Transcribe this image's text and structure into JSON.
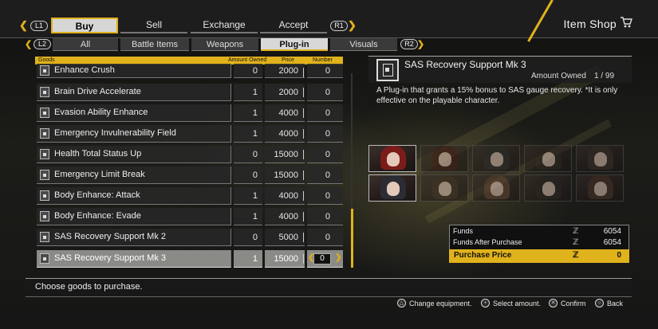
{
  "header": {
    "left_shoulder": "L1",
    "right_shoulder": "R1",
    "tabs": [
      {
        "label": "Buy",
        "active": true
      },
      {
        "label": "Sell",
        "active": false
      },
      {
        "label": "Exchange",
        "active": false
      },
      {
        "label": "Accept",
        "active": false
      }
    ],
    "title": "Item Shop"
  },
  "subtabs": {
    "left_shoulder": "L2",
    "right_shoulder": "R2",
    "items": [
      {
        "label": "All",
        "active": false
      },
      {
        "label": "Battle Items",
        "active": false
      },
      {
        "label": "Weapons",
        "active": false
      },
      {
        "label": "Plug-in",
        "active": true
      },
      {
        "label": "Visuals",
        "active": false
      }
    ]
  },
  "list": {
    "columns": {
      "goods": "Goods",
      "owned": "Amount Owned",
      "price": "Price",
      "number": "Number"
    },
    "rows": [
      {
        "name": "Enhance Crush",
        "owned": "0",
        "price": "2000",
        "number": "0"
      },
      {
        "name": "Brain Drive Accelerate",
        "owned": "1",
        "price": "2000",
        "number": "0"
      },
      {
        "name": "Evasion Ability Enhance",
        "owned": "1",
        "price": "4000",
        "number": "0"
      },
      {
        "name": "Emergency Invulnerability Field",
        "owned": "1",
        "price": "4000",
        "number": "0"
      },
      {
        "name": "Health Total Status Up",
        "owned": "0",
        "price": "15000",
        "number": "0"
      },
      {
        "name": "Emergency Limit Break",
        "owned": "0",
        "price": "15000",
        "number": "0"
      },
      {
        "name": "Body Enhance: Attack",
        "owned": "1",
        "price": "4000",
        "number": "0"
      },
      {
        "name": "Body Enhance: Evade",
        "owned": "1",
        "price": "4000",
        "number": "0"
      },
      {
        "name": "SAS Recovery Support Mk 2",
        "owned": "0",
        "price": "5000",
        "number": "0"
      },
      {
        "name": "SAS Recovery Support Mk 3",
        "owned": "1",
        "price": "15000",
        "number": "0",
        "selected": true
      }
    ]
  },
  "detail": {
    "name": "SAS Recovery Support Mk 3",
    "owned_label": "Amount Owned",
    "owned_value": "1 / 99",
    "description": "A Plug-in that grants a 15% bonus to SAS gauge recovery. *It is only effective on the playable character."
  },
  "funds": {
    "funds_label": "Funds",
    "funds_value": "6054",
    "after_label": "Funds After Purchase",
    "after_value": "6054",
    "price_label": "Purchase Price",
    "price_value": "0"
  },
  "message": "Choose goods to purchase.",
  "hints": [
    {
      "icon": "triangle-icon",
      "label": "Change equipment."
    },
    {
      "icon": "dpad-icon",
      "label": "Select amount."
    },
    {
      "icon": "cross-icon",
      "label": "Confirm"
    },
    {
      "icon": "circle-icon",
      "label": "Back"
    }
  ],
  "colors": {
    "accent": "#e0b21c",
    "panel": "#1d1d1d",
    "selected_row": "#8a8a86"
  }
}
